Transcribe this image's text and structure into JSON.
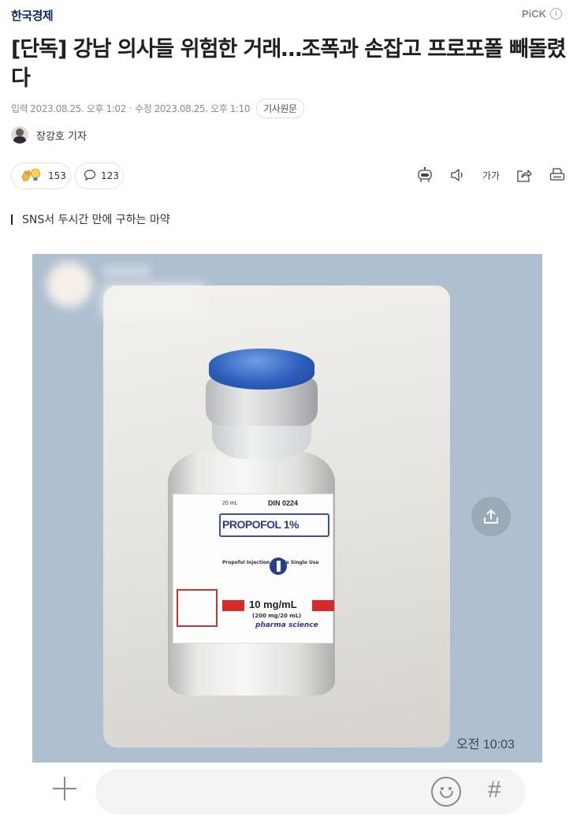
{
  "header": {
    "press_name": "한국경제",
    "pick_label": "PiCK",
    "info_glyph": "i"
  },
  "article": {
    "headline": "[단독] 강남 의사들 위험한 거래…조폭과 손잡고 프로포폴 빼돌렸다",
    "published_label": "입력",
    "published_date": "2023.08.25. 오후 1:02",
    "separator": "·",
    "modified_label": "수정",
    "modified_date": "2023.08.25. 오후 1:10",
    "source_button": "기사원문",
    "reporter": "장강호 기자",
    "subheading": "SNS서 두시간 만에 구하는 마약"
  },
  "actions": {
    "reaction_count": "153",
    "comment_count": "123",
    "text_size_label": "가가"
  },
  "photo": {
    "vial_volume": "20 mL",
    "vial_din": "DIN 0224",
    "vial_drug": "PROPOFOL 1%",
    "vial_injection": "Propofol Injection Sterile Single Use",
    "vial_dose": "10 mg/mL",
    "vial_dose_total": "(200 mg/20 mL)",
    "vial_brand": "pharma science",
    "message_time": "오전 10:03"
  },
  "icons": {
    "reactions": "clap-bulb-icon",
    "comment": "speech-bubble-icon",
    "bot": "robot-icon",
    "audio": "speaker-icon",
    "share": "share-icon",
    "print": "print-icon",
    "chat_share": "upload-icon",
    "add": "plus-icon",
    "emoji": "smiley-icon",
    "hashtag": "hash-icon"
  },
  "composer": {
    "hash_glyph": "#"
  },
  "colors": {
    "press": "#0d2a66",
    "chat_background": "#aebfd0",
    "vial_cap": "#2d5fbc",
    "label_accent": "#2a3c8e"
  }
}
